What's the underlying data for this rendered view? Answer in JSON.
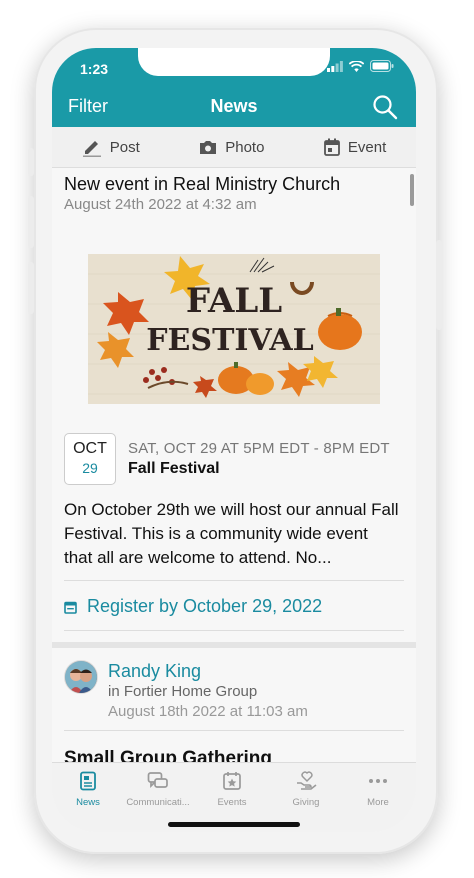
{
  "status": {
    "time": "1:23"
  },
  "nav": {
    "filter_label": "Filter",
    "title": "News"
  },
  "compose": {
    "post_label": "Post",
    "photo_label": "Photo",
    "event_label": "Event"
  },
  "post1": {
    "title": "New event in Real Ministry Church",
    "date": "August 24th 2022 at 4:32 am",
    "banner_line1": "FALL",
    "banner_line2": "FESTIVAL",
    "cal_month": "OCT",
    "cal_day": "29",
    "event_when": "SAT, OCT 29 AT 5PM EDT - 8PM EDT",
    "event_name": "Fall Festival",
    "description": "On October 29th we will host our annual Fall Festival. This is a community wide event that all are welcome to attend. No...",
    "register_label": "Register by October 29, 2022"
  },
  "post2": {
    "author": "Randy King",
    "group": "in Fortier Home Group",
    "date": "August 18th 2022 at 11:03 am",
    "title": "Small Group Gathering"
  },
  "tabs": [
    {
      "label": "News",
      "icon": "news-icon",
      "active": true
    },
    {
      "label": "Communicati...",
      "icon": "chat-icon",
      "active": false
    },
    {
      "label": "Events",
      "icon": "calendar-star-icon",
      "active": false
    },
    {
      "label": "Giving",
      "icon": "giving-hand-icon",
      "active": false
    },
    {
      "label": "More",
      "icon": "more-dots-icon",
      "active": false
    }
  ],
  "colors": {
    "brand": "#1a9aa7",
    "link": "#1a8ba0"
  }
}
